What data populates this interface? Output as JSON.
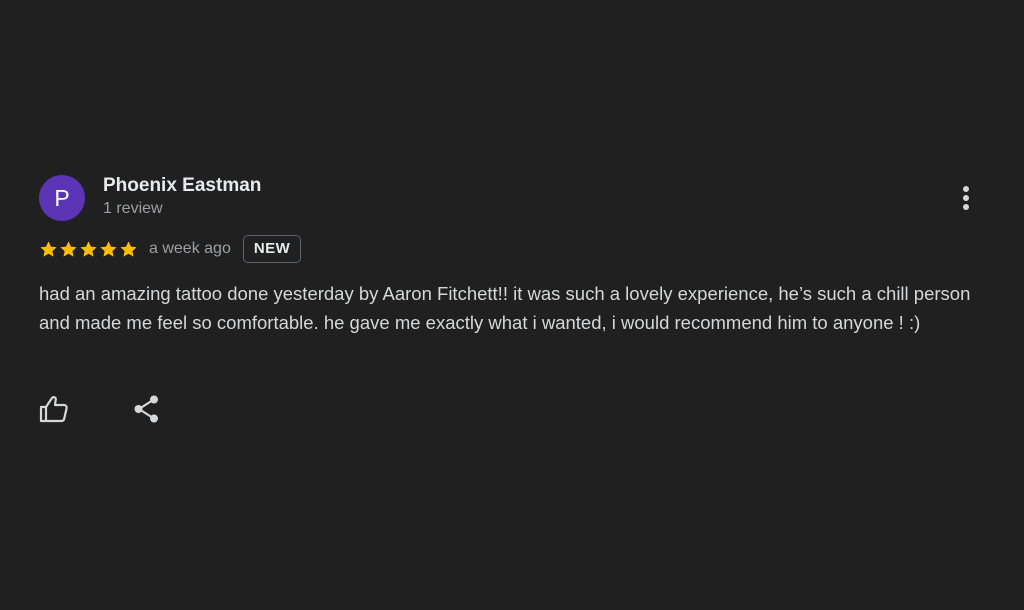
{
  "review": {
    "avatar_letter": "P",
    "avatar_color": "#5b35b5",
    "author_name": "Phoenix Eastman",
    "review_count": "1 review",
    "rating": 5,
    "rating_max": 5,
    "star_color": "#fbbc04",
    "date": "a week ago",
    "badge": "NEW",
    "text": "had an amazing tattoo done yesterday by Aaron Fitchett!! it was such a lovely experience, he’s such a chill person and made me feel so comfortable. he gave me exactly what i wanted, i would recommend him to anyone ! :)"
  },
  "actions": {
    "like_icon": "thumb-up-icon",
    "share_icon": "share-icon",
    "more_icon": "more-vert-icon"
  }
}
